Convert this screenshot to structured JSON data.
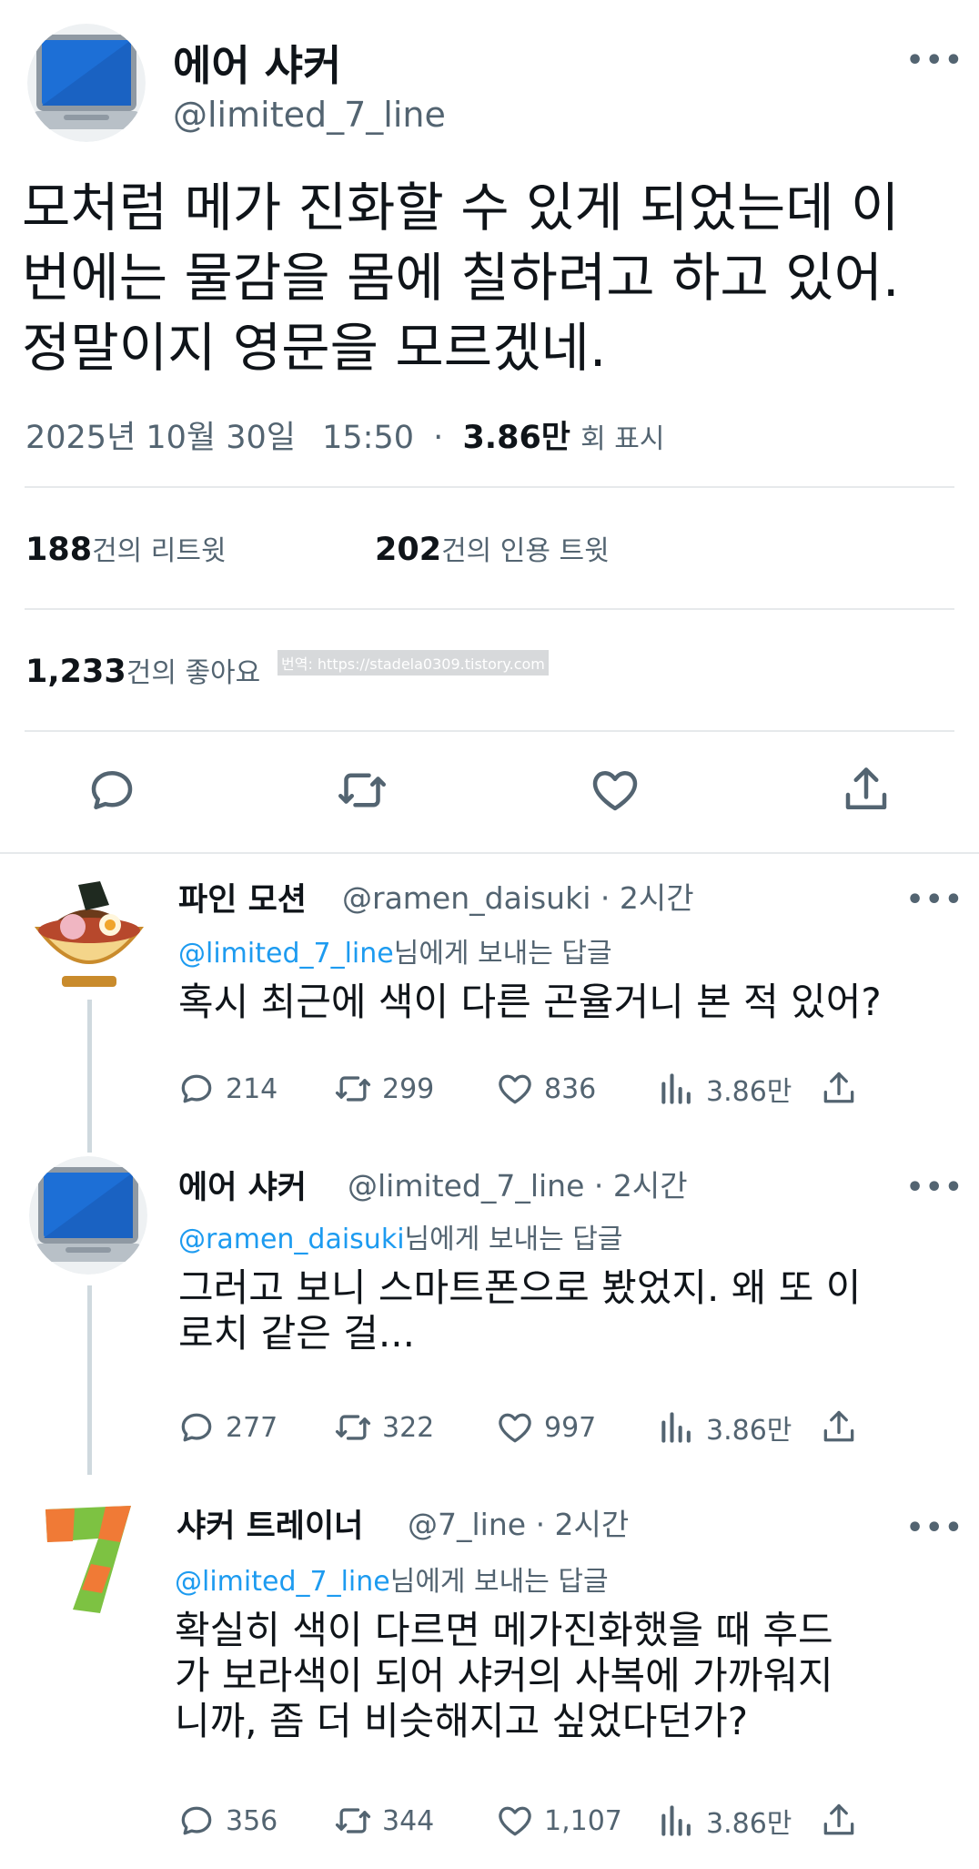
{
  "main_tweet": {
    "display_name": "에어 샤커",
    "handle": "@limited_7_line",
    "text_lines": [
      "모처럼 메가 진화할 수 있게 되었는데 이",
      "번에는 물감을 몸에 칠하려고 하고 있어.",
      "정말이지 영문을 모르겠네."
    ],
    "date": "2025년 10월 30일",
    "time": "15:50",
    "views": "3.86만",
    "views_label": "회 표시",
    "retweets": "188",
    "retweets_label": "건의 리트윗",
    "quotes": "202",
    "quotes_label": "건의 인용 트윗",
    "likes": "1,233",
    "likes_label": "건의 좋아요",
    "watermark": "번역: https://stadela0309.tistory.com",
    "more_icon": "more-dots-icon"
  },
  "replies": [
    {
      "display_name": "파인 모션",
      "handle": "@ramen_daisuki",
      "time": "· 2시간",
      "reply_to_handle": "@limited_7_line",
      "reply_to_suffix": "님에게 보내는 답글",
      "text_lines": [
        "혹시 최근에 색이 다른 곤율거니 본 적 있어?"
      ],
      "comments": "214",
      "retweets": "299",
      "likes": "836",
      "views": "3.86만"
    },
    {
      "display_name": "에어 샤커",
      "handle": "@limited_7_line",
      "time": "· 2시간",
      "reply_to_handle": "@ramen_daisuki",
      "reply_to_suffix": "님에게 보내는 답글",
      "text_lines": [
        "그러고 보니 스마트폰으로 봤었지. 왜 또 이",
        "로치 같은  걸..."
      ],
      "comments": "277",
      "retweets": "322",
      "likes": "997",
      "views": "3.86만"
    },
    {
      "display_name": "샤커 트레이너",
      "handle": "@7_line",
      "time": "· 2시간",
      "reply_to_handle": "@limited_7_line",
      "reply_to_suffix": "님에게 보내는 답글",
      "text_lines": [
        "확실히 색이 다르면 메가진화했을 때 후드",
        "가 보라색이 되어 샤커의 사복에 가까워지",
        "니까, 좀 더 비슷해지고 싶었다던가?"
      ],
      "comments": "356",
      "retweets": "344",
      "likes": "1,107",
      "views": "3.86만"
    }
  ],
  "colors": {
    "text": "#0f1419",
    "secondary": "#536471",
    "link": "#1d9bf0",
    "divider": "#e6e9eb"
  },
  "icons": [
    "reply-icon",
    "retweet-icon",
    "like-icon",
    "share-icon",
    "views-icon",
    "more-dots-icon"
  ]
}
